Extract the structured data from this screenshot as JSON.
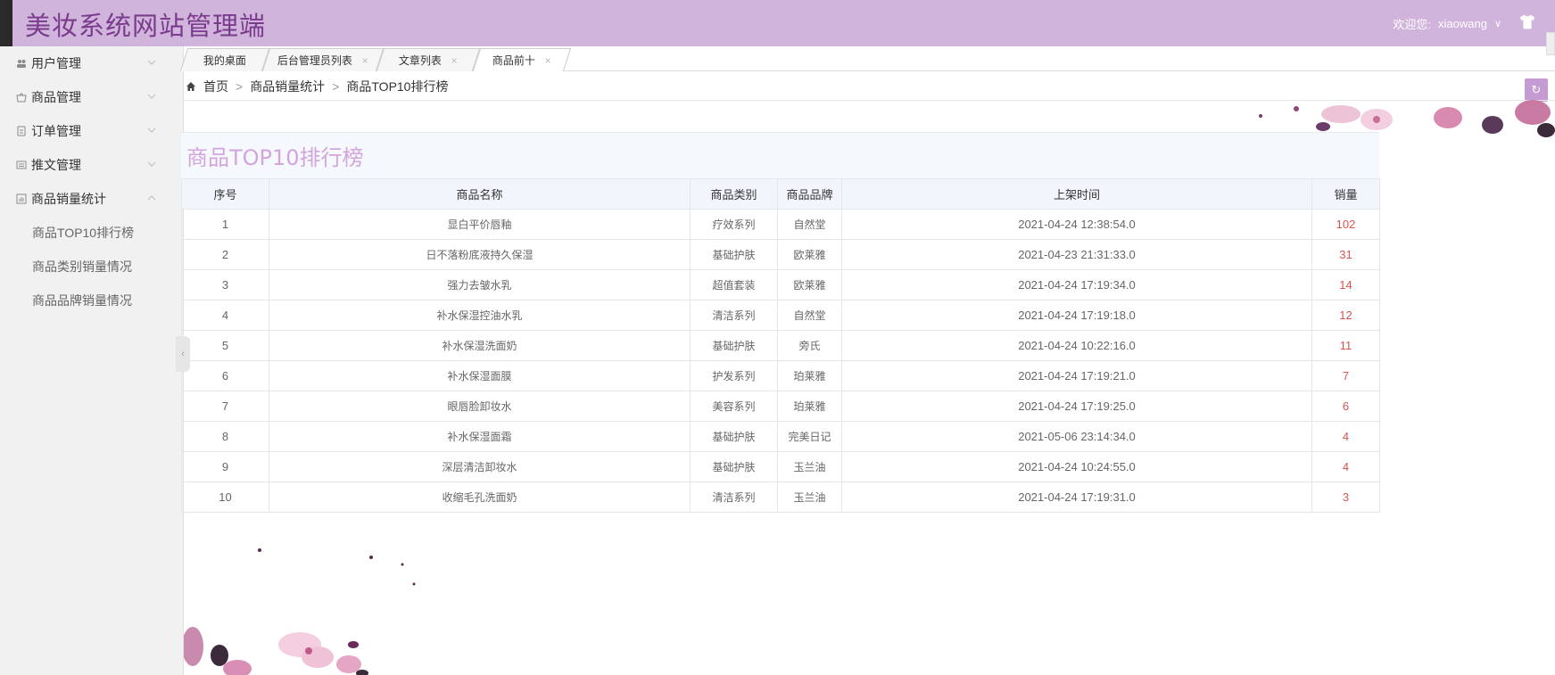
{
  "header": {
    "logo": "美妆系统网站管理端",
    "welcome_label": "欢迎您:",
    "username": "xiaowang",
    "chevron": "∨"
  },
  "sidebar": {
    "items": [
      {
        "label": "用户管理",
        "icon": "users-icon",
        "expanded": false
      },
      {
        "label": "商品管理",
        "icon": "cart-icon",
        "expanded": false
      },
      {
        "label": "订单管理",
        "icon": "document-icon",
        "expanded": false
      },
      {
        "label": "推文管理",
        "icon": "article-icon",
        "expanded": false
      },
      {
        "label": "商品销量统计",
        "icon": "chart-icon",
        "expanded": true,
        "children": [
          "商品TOP10排行榜",
          "商品类别销量情况",
          "商品品牌销量情况"
        ]
      }
    ]
  },
  "tabs": [
    {
      "label": "我的桌面",
      "closable": false
    },
    {
      "label": "后台管理员列表",
      "closable": true
    },
    {
      "label": "文章列表",
      "closable": true
    },
    {
      "label": "商品前十",
      "closable": true,
      "active": true
    }
  ],
  "breadcrumb": [
    "首页",
    "商品销量统计",
    "商品TOP10排行榜"
  ],
  "breadcrumb_sep": ">",
  "panel": {
    "title": "商品TOP10排行榜",
    "columns": [
      "序号",
      "商品名称",
      "商品类别",
      "商品品牌",
      "上架时间",
      "销量"
    ],
    "rows": [
      {
        "idx": "1",
        "name": "显白平价唇釉",
        "category": "疗效系列",
        "brand": "自然堂",
        "time": "2021-04-24 12:38:54.0",
        "sales": "102"
      },
      {
        "idx": "2",
        "name": "日不落粉底液持久保湿",
        "category": "基础护肤",
        "brand": "欧莱雅",
        "time": "2021-04-23 21:31:33.0",
        "sales": "31"
      },
      {
        "idx": "3",
        "name": "强力去皱水乳",
        "category": "超值套装",
        "brand": "欧莱雅",
        "time": "2021-04-24 17:19:34.0",
        "sales": "14"
      },
      {
        "idx": "4",
        "name": "补水保湿控油水乳",
        "category": "清洁系列",
        "brand": "自然堂",
        "time": "2021-04-24 17:19:18.0",
        "sales": "12"
      },
      {
        "idx": "5",
        "name": "补水保湿洗面奶",
        "category": "基础护肤",
        "brand": "旁氏",
        "time": "2021-04-24 10:22:16.0",
        "sales": "11"
      },
      {
        "idx": "6",
        "name": "补水保湿面膜",
        "category": "护发系列",
        "brand": "珀莱雅",
        "time": "2021-04-24 17:19:21.0",
        "sales": "7"
      },
      {
        "idx": "7",
        "name": "眼唇脸卸妆水",
        "category": "美容系列",
        "brand": "珀莱雅",
        "time": "2021-04-24 17:19:25.0",
        "sales": "6"
      },
      {
        "idx": "8",
        "name": "补水保湿面霜",
        "category": "基础护肤",
        "brand": "完美日记",
        "time": "2021-05-06 23:14:34.0",
        "sales": "4"
      },
      {
        "idx": "9",
        "name": "深层清洁卸妆水",
        "category": "基础护肤",
        "brand": "玉兰油",
        "time": "2021-04-24 10:24:55.0",
        "sales": "4"
      },
      {
        "idx": "10",
        "name": "收缩毛孔洗面奶",
        "category": "清洁系列",
        "brand": "玉兰油",
        "time": "2021-04-24 17:19:31.0",
        "sales": "3"
      }
    ]
  },
  "colors": {
    "header_bg": "#d0b4dc",
    "logo": "#7a3b8d",
    "title": "#d3a5dc",
    "sales": "#d9534f",
    "refresh_btn": "#c59bd3"
  }
}
